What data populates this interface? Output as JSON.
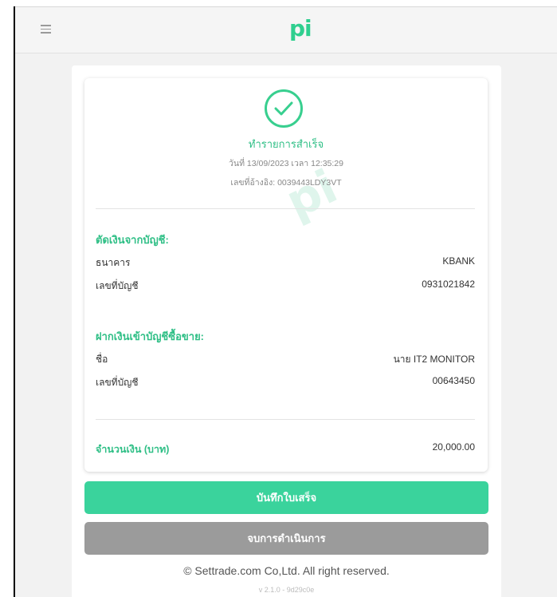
{
  "header": {
    "logo_text": "pi",
    "menu_icon": "hamburger-menu-icon"
  },
  "receipt": {
    "status_icon": "check-circle-icon",
    "status_text": "ทำรายการสำเร็จ",
    "datetime": "วันที่ 13/09/2023 เวลา 12:35:29",
    "reference": "เลขที่อ้างอิง: 0039443LDY3VT",
    "watermark": "pi",
    "debit_section": {
      "title": "ตัดเงินจากบัญชี:",
      "bank_label": "ธนาคาร",
      "bank_value": "KBANK",
      "account_label": "เลขที่บัญชี",
      "account_value": "0931021842"
    },
    "deposit_section": {
      "title": "ฝากเงินเข้าบัญชีซื้อขาย:",
      "name_label": "ชื่อ",
      "name_value": "นาย IT2 MONITOR",
      "account_label": "เลขที่บัญชี",
      "account_value": "00643450"
    },
    "amount": {
      "label": "จำนวนเงิน (บาท)",
      "value": "20,000.00"
    }
  },
  "actions": {
    "save_label": "บันทึกใบเสร็จ",
    "end_label": "จบการดำเนินการ"
  },
  "footer": {
    "copyright": "© Settrade.com Co,Ltd. All right reserved.",
    "version": "v 2.1.0 - 9d29c0e"
  },
  "colors": {
    "accent": "#3ad39c",
    "accent_text": "#2fbf86",
    "secondary_button": "#9b9b9b"
  }
}
